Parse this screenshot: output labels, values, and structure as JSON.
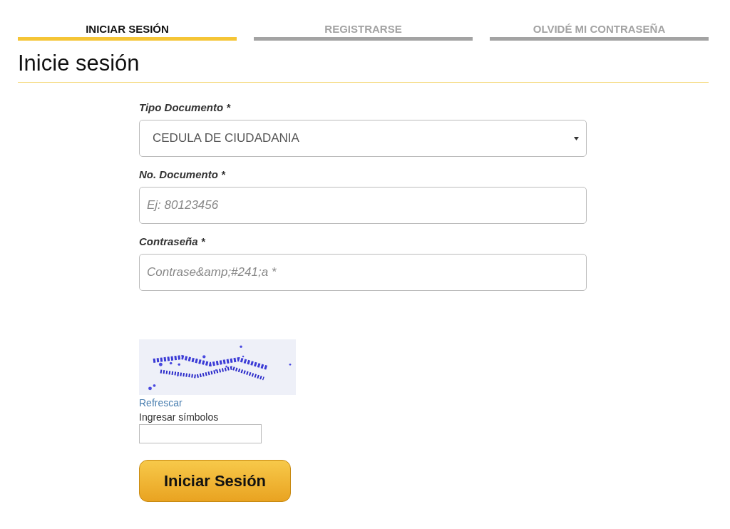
{
  "tabs": [
    {
      "label": "INICIAR SESIÓN",
      "selected": true
    },
    {
      "label": "REGISTRARSE",
      "selected": false
    },
    {
      "label": "OLVIDÉ MI CONTRASEÑA",
      "selected": false
    }
  ],
  "heading": "Inicie sesión",
  "fields": [
    {
      "kind": "select",
      "label": "Tipo Documento *",
      "value": "CEDULA DE CIUDADANIA"
    },
    {
      "kind": "input",
      "label": "No. Documento *",
      "placeholder": "Ej: 80123456"
    },
    {
      "kind": "input",
      "label": "Contraseña *",
      "placeholder": "Contrase&amp;#241;a *"
    }
  ],
  "captcha": {
    "refresh_link": "Refrescar",
    "label": "Ingresar símbolos"
  },
  "submit_button": "Iniciar Sesión"
}
